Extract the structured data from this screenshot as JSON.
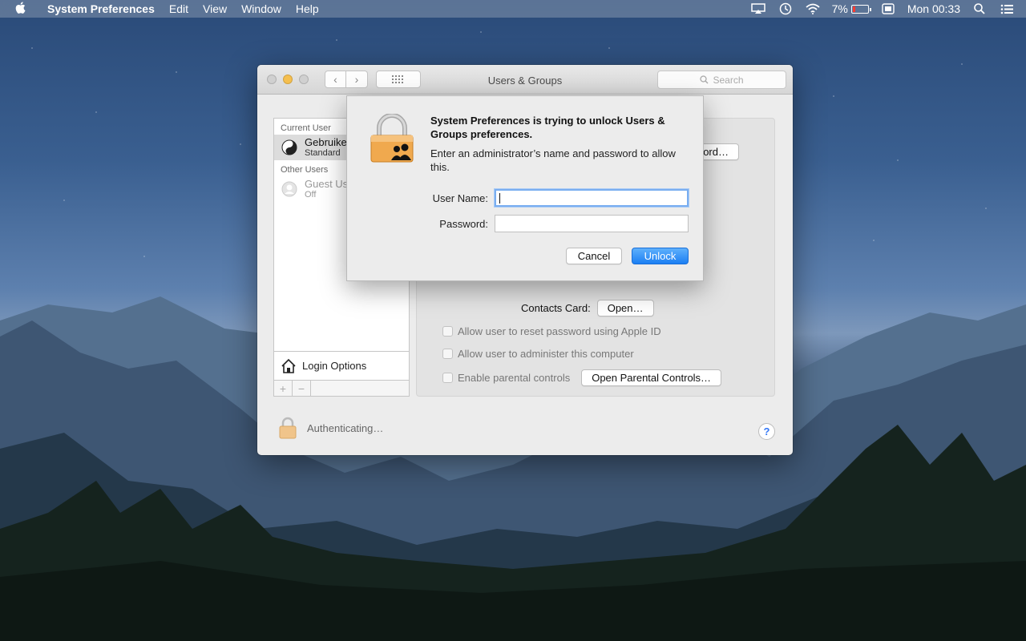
{
  "menubar": {
    "app_name": "System Preferences",
    "items": [
      "Edit",
      "View",
      "Window",
      "Help"
    ],
    "battery_percent": "7%",
    "clock": "Mon 00:33"
  },
  "window": {
    "title": "Users & Groups",
    "search_placeholder": "Search"
  },
  "sidebar": {
    "current_user_label": "Current User",
    "current_user": {
      "name": "Gebruiker",
      "role": "Standard"
    },
    "other_users_label": "Other Users",
    "other_user": {
      "name": "Guest User",
      "role": "Off"
    },
    "login_options": "Login Options",
    "add": "+",
    "remove": "−"
  },
  "main": {
    "change_password": "Change Password…",
    "contacts_card_label": "Contacts Card:",
    "open_button": "Open…",
    "reset_password": "Allow user to reset password using Apple ID",
    "administer": "Allow user to administer this computer",
    "parental": "Enable parental controls",
    "open_parental": "Open Parental Controls…",
    "status": "Authenticating…",
    "help": "?"
  },
  "dialog": {
    "title": "System Preferences is trying to unlock Users & Groups preferences.",
    "message": "Enter an administrator’s name and password to allow this.",
    "username_label": "User Name:",
    "password_label": "Password:",
    "username_value": "",
    "password_value": "",
    "cancel": "Cancel",
    "unlock": "Unlock"
  }
}
